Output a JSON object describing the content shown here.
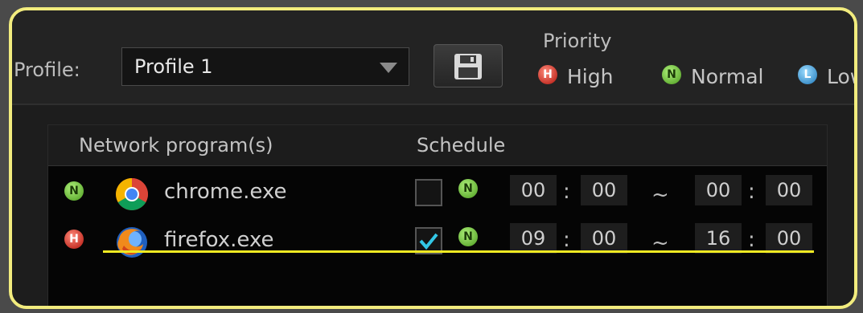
{
  "toolbar": {
    "profile_label": "Profile:",
    "profile_value": "Profile 1",
    "save_icon": "floppy-disk-icon",
    "priority_title": "Priority",
    "legend": [
      {
        "badge": "H",
        "label": "High"
      },
      {
        "badge": "N",
        "label": "Normal"
      },
      {
        "badge": "L",
        "label": "Low"
      }
    ]
  },
  "table": {
    "headers": {
      "program": "Network program(s)",
      "schedule": "Schedule"
    },
    "rows": [
      {
        "priority": "N",
        "icon": "chrome-icon",
        "name": "chrome.exe",
        "scheduled": false,
        "sched_priority": "N",
        "start_h": "00",
        "start_m": "00",
        "end_h": "00",
        "end_m": "00"
      },
      {
        "priority": "H",
        "icon": "firefox-icon",
        "name": "firefox.exe",
        "scheduled": true,
        "sched_priority": "N",
        "start_h": "09",
        "start_m": "00",
        "end_h": "16",
        "end_m": "00"
      }
    ],
    "time_separator": ":",
    "range_separator": "~"
  },
  "colors": {
    "frame_highlight": "#f2ec7e",
    "underline_highlight": "#f0ea22",
    "check_accent": "#33c7e6"
  }
}
